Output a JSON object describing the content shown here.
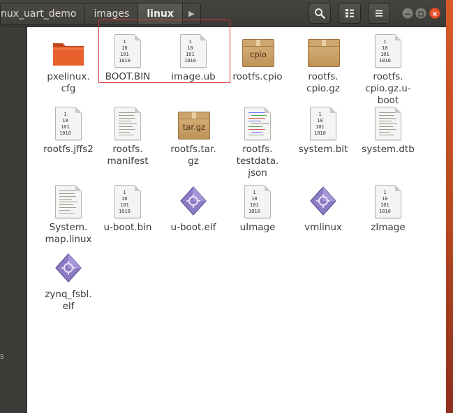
{
  "breadcrumbs": [
    "nux_uart_demo",
    "images",
    "linux"
  ],
  "colors": {
    "highlight": "#d9363e",
    "folder": "#e8602c",
    "titlebar": "#3c3b37"
  },
  "toolbar": {
    "icons": [
      "search-icon",
      "view-list-icon",
      "menu-icon"
    ]
  },
  "window_controls": [
    "minimize-icon",
    "maximize-icon",
    "close-icon"
  ],
  "sidebar": {
    "text": "s"
  },
  "files": [
    {
      "label": "pxelinux.\ncfg",
      "icon": "folder"
    },
    {
      "label": "BOOT.BIN",
      "icon": "binary"
    },
    {
      "label": "image.ub",
      "icon": "binary"
    },
    {
      "label": "rootfs.cpio",
      "icon": "archive",
      "badge": "cpio"
    },
    {
      "label": "rootfs.\ncpio.gz",
      "icon": "archive"
    },
    {
      "label": "rootfs.\ncpio.gz.u-\nboot",
      "icon": "binary"
    },
    {
      "label": "rootfs.jffs2",
      "icon": "binary"
    },
    {
      "label": "rootfs.\nmanifest",
      "icon": "text"
    },
    {
      "label": "rootfs.tar.\ngz",
      "icon": "archive",
      "badge": "tar.gz"
    },
    {
      "label": "rootfs.\ntestdata.\njson",
      "icon": "code"
    },
    {
      "label": "system.bit",
      "icon": "binary"
    },
    {
      "label": "system.dtb",
      "icon": "text"
    },
    {
      "label": "System.\nmap.linux",
      "icon": "text"
    },
    {
      "label": "u-boot.bin",
      "icon": "binary"
    },
    {
      "label": "u-boot.elf",
      "icon": "executable"
    },
    {
      "label": "uImage",
      "icon": "binary"
    },
    {
      "label": "vmlinux",
      "icon": "executable"
    },
    {
      "label": "zImage",
      "icon": "binary"
    },
    {
      "label": "zynq_fsbl.\nelf",
      "icon": "executable"
    }
  ],
  "binary_glyph": [
    "1",
    "10",
    "101",
    "1010"
  ]
}
